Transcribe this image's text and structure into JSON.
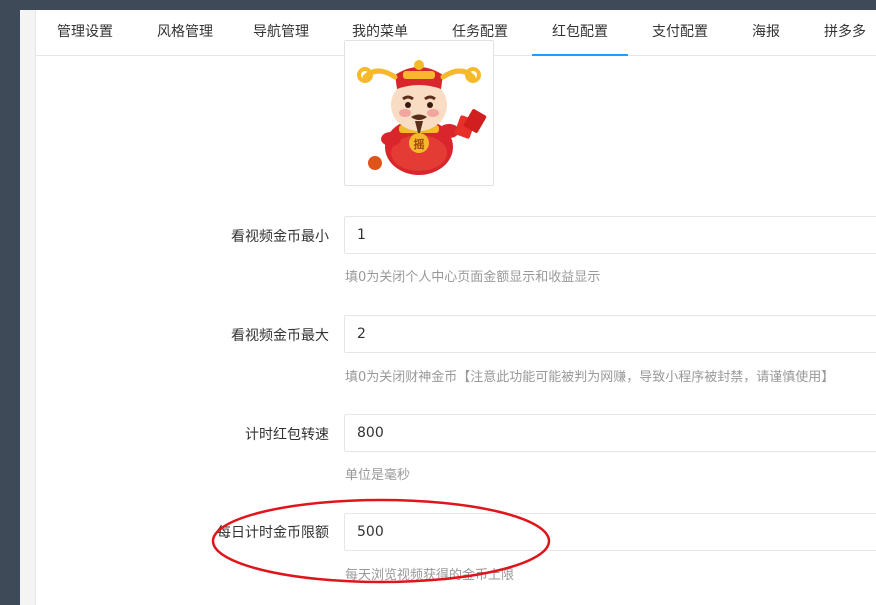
{
  "tabs": [
    {
      "label": "管理设置"
    },
    {
      "label": "风格管理"
    },
    {
      "label": "导航管理"
    },
    {
      "label": "我的菜单"
    },
    {
      "label": "任务配置"
    },
    {
      "label": "红包配置",
      "active": true
    },
    {
      "label": "支付配置"
    },
    {
      "label": "海报"
    },
    {
      "label": "拼多多"
    }
  ],
  "form": {
    "image_glyph": "摇",
    "fields": [
      {
        "label": "看视频金币最小",
        "value": "1",
        "hint": "填0为关闭个人中心页面金额显示和收益显示"
      },
      {
        "label": "看视频金币最大",
        "value": "2",
        "hint": "填0为关闭财神金币【注意此功能可能被判为网赚，导致小程序被封禁，请谨慎使用】"
      },
      {
        "label": "计时红包转速",
        "value": "800",
        "hint": "单位是毫秒"
      },
      {
        "label": "每日计时金币限额",
        "value": "500",
        "hint": "每天浏览视频获得的金币上限"
      }
    ]
  },
  "colors": {
    "accent": "#1e9fff",
    "annotation": "#e0151b",
    "sidebar": "#3f4a58"
  }
}
